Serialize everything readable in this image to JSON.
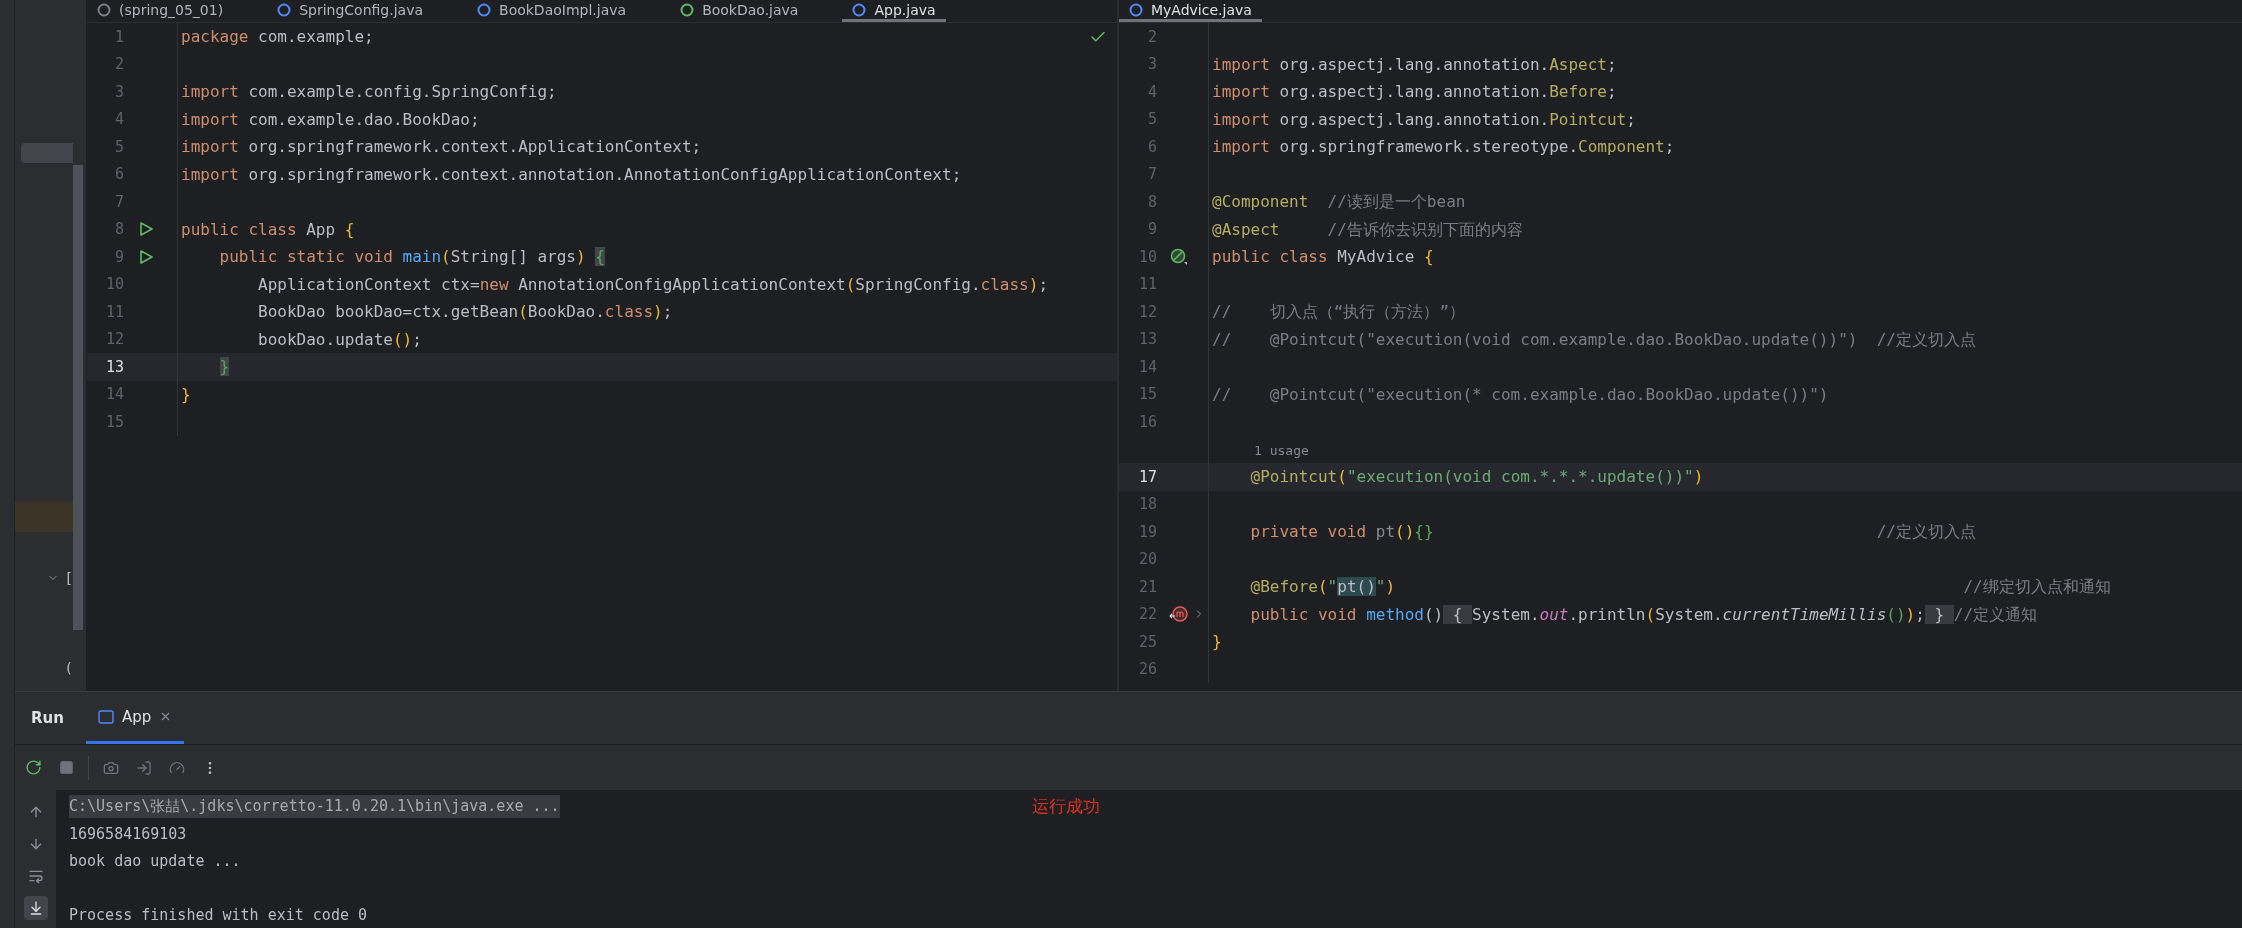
{
  "project_panel": {
    "tree_texts": [
      "[",
      "("
    ]
  },
  "left_editor": {
    "tabs": [
      {
        "label": "(spring_05_01)",
        "color": "#7a7e85",
        "selected": false
      },
      {
        "label": "SpringConfig.java",
        "color": "#548af7",
        "selected": false
      },
      {
        "label": "BookDaoImpl.java",
        "color": "#548af7",
        "selected": false
      },
      {
        "label": "BookDao.java",
        "color": "#5fb865",
        "selected": false
      },
      {
        "label": "App.java",
        "color": "#548af7",
        "selected": true
      }
    ],
    "lines": [
      {
        "kind": "code",
        "number": "1",
        "current": false,
        "tokens": [
          {
            "kind": "kw",
            "text": "package"
          },
          {
            "kind": "plain",
            "text": " com.example;"
          }
        ]
      },
      {
        "kind": "code",
        "number": "2",
        "current": false
      },
      {
        "kind": "code",
        "number": "3",
        "current": false,
        "tokens": [
          {
            "kind": "kw",
            "text": "import"
          },
          {
            "kind": "plain",
            "text": " com.example.config.SpringConfig;"
          }
        ]
      },
      {
        "kind": "code",
        "number": "4",
        "current": false,
        "tokens": [
          {
            "kind": "kw",
            "text": "import"
          },
          {
            "kind": "plain",
            "text": " com.example.dao.BookDao;"
          }
        ]
      },
      {
        "kind": "code",
        "number": "5",
        "current": false,
        "tokens": [
          {
            "kind": "kw",
            "text": "import"
          },
          {
            "kind": "plain",
            "text": " org.springframework.context.ApplicationContext;"
          }
        ]
      },
      {
        "kind": "code",
        "number": "6",
        "current": false,
        "tokens": [
          {
            "kind": "kw",
            "text": "import"
          },
          {
            "kind": "plain",
            "text": " org.springframework.context.annotation.AnnotationConfigApplicationContext;"
          }
        ]
      },
      {
        "kind": "code",
        "number": "7",
        "current": false
      },
      {
        "kind": "code",
        "number": "8",
        "current": false,
        "gutter": {
          "kind": "run"
        },
        "tokens": [
          {
            "kind": "kw",
            "text": "public class"
          },
          {
            "kind": "plain",
            "text": " App "
          },
          {
            "kind": "brace",
            "text": "{"
          }
        ]
      },
      {
        "kind": "code",
        "number": "9",
        "current": false,
        "gutter": {
          "kind": "run"
        },
        "tokens": [
          {
            "kind": "kw",
            "text": "    public static void "
          },
          {
            "kind": "decl",
            "text": "main"
          },
          {
            "kind": "brace",
            "text": "("
          },
          {
            "kind": "plain",
            "text": "String[] args"
          },
          {
            "kind": "brace",
            "text": ") "
          },
          {
            "kind": "match",
            "text": "{"
          }
        ]
      },
      {
        "kind": "code",
        "number": "10",
        "current": false,
        "tokens": [
          {
            "kind": "plain",
            "text": "        ApplicationContext ctx="
          },
          {
            "kind": "kw",
            "text": "new"
          },
          {
            "kind": "plain",
            "text": " AnnotationConfigApplicationContext"
          },
          {
            "kind": "brace",
            "text": "("
          },
          {
            "kind": "plain",
            "text": "SpringConfig."
          },
          {
            "kind": "kw",
            "text": "class"
          },
          {
            "kind": "brace",
            "text": ")"
          },
          {
            "kind": "plain",
            "text": ";"
          }
        ]
      },
      {
        "kind": "code",
        "number": "11",
        "current": false,
        "tokens": [
          {
            "kind": "plain",
            "text": "        BookDao bookDao=ctx.getBean"
          },
          {
            "kind": "brace",
            "text": "("
          },
          {
            "kind": "plain",
            "text": "BookDao."
          },
          {
            "kind": "kw",
            "text": "class"
          },
          {
            "kind": "brace",
            "text": ")"
          },
          {
            "kind": "plain",
            "text": ";"
          }
        ]
      },
      {
        "kind": "code",
        "number": "12",
        "current": false,
        "tokens": [
          {
            "kind": "plain",
            "text": "        bookDao.update"
          },
          {
            "kind": "brace",
            "text": "()"
          },
          {
            "kind": "plain",
            "text": ";"
          }
        ]
      },
      {
        "kind": "code",
        "number": "13",
        "current": true,
        "tokens": [
          {
            "kind": "match",
            "text": "    }"
          }
        ]
      },
      {
        "kind": "code",
        "number": "14",
        "current": false,
        "tokens": [
          {
            "kind": "brace",
            "text": "}"
          }
        ]
      },
      {
        "kind": "code",
        "number": "15",
        "current": false
      }
    ]
  },
  "right_editor": {
    "tabs": [
      {
        "label": "MyAdvice.java",
        "color": "#548af7",
        "selected": true
      }
    ],
    "lines": [
      {
        "kind": "code",
        "number": "2",
        "current": false
      },
      {
        "kind": "code",
        "number": "3",
        "current": false,
        "tokens": [
          {
            "kind": "kw",
            "text": "import"
          },
          {
            "kind": "plain",
            "text": " org.aspectj.lang.annotation."
          },
          {
            "kind": "annot",
            "text": "Aspect"
          },
          {
            "kind": "plain",
            "text": ";"
          }
        ]
      },
      {
        "kind": "code",
        "number": "4",
        "current": false,
        "tokens": [
          {
            "kind": "kw",
            "text": "import"
          },
          {
            "kind": "plain",
            "text": " org.aspectj.lang.annotation."
          },
          {
            "kind": "annot",
            "text": "Before"
          },
          {
            "kind": "plain",
            "text": ";"
          }
        ]
      },
      {
        "kind": "code",
        "number": "5",
        "current": false,
        "tokens": [
          {
            "kind": "kw",
            "text": "import"
          },
          {
            "kind": "plain",
            "text": " org.aspectj.lang.annotation."
          },
          {
            "kind": "annot",
            "text": "Pointcut"
          },
          {
            "kind": "plain",
            "text": ";"
          }
        ]
      },
      {
        "kind": "code",
        "number": "6",
        "current": false,
        "tokens": [
          {
            "kind": "kw",
            "text": "import"
          },
          {
            "kind": "plain",
            "text": " org.springframework.stereotype."
          },
          {
            "kind": "annot",
            "text": "Component"
          },
          {
            "kind": "plain",
            "text": ";"
          }
        ]
      },
      {
        "kind": "code",
        "number": "7",
        "current": false
      },
      {
        "kind": "code",
        "number": "8",
        "current": false,
        "tokens": [
          {
            "kind": "annot",
            "text": "@Component"
          },
          {
            "kind": "comment",
            "text": "  //读到是一个bean"
          }
        ]
      },
      {
        "kind": "code",
        "number": "9",
        "current": false,
        "tokens": [
          {
            "kind": "annot",
            "text": "@Aspect"
          },
          {
            "kind": "comment",
            "text": "     //告诉你去识别下面的内容"
          }
        ]
      },
      {
        "kind": "code",
        "number": "10",
        "current": false,
        "gutter": {
          "kind": "bean"
        },
        "tokens": [
          {
            "kind": "kw",
            "text": "public class"
          },
          {
            "kind": "plain",
            "text": " MyAdvice "
          },
          {
            "kind": "brace",
            "text": "{"
          }
        ]
      },
      {
        "kind": "code",
        "number": "11",
        "current": false
      },
      {
        "kind": "code",
        "number": "12",
        "current": false,
        "tokens": [
          {
            "kind": "comment",
            "text": "//    切入点（“执行（方法）”）"
          }
        ]
      },
      {
        "kind": "code",
        "number": "13",
        "current": false,
        "tokens": [
          {
            "kind": "comment",
            "text": "//    @Pointcut(\"execution(void com.example.dao.BookDao.update())\")  //定义切入点"
          }
        ]
      },
      {
        "kind": "code",
        "number": "14",
        "current": false
      },
      {
        "kind": "code",
        "number": "15",
        "current": false,
        "tokens": [
          {
            "kind": "comment",
            "text": "//    @Pointcut(\"execution(* com.example.dao.BookDao.update())\")"
          }
        ]
      },
      {
        "kind": "code",
        "number": "16",
        "current": false
      },
      {
        "kind": "inlay",
        "text": "1 usage",
        "current": false
      },
      {
        "kind": "code",
        "number": "17",
        "current": true,
        "tokens": [
          {
            "kind": "annot",
            "text": "    @Pointcut"
          },
          {
            "kind": "brace",
            "text": "("
          },
          {
            "kind": "str",
            "text": "\"execution(void com.*.*.*.update())\""
          },
          {
            "kind": "brace",
            "text": ")"
          }
        ]
      },
      {
        "kind": "code",
        "number": "18",
        "current": false
      },
      {
        "kind": "code",
        "number": "19",
        "current": false,
        "tokens": [
          {
            "kind": "kw",
            "text": "    private void "
          },
          {
            "kind": "dim",
            "text": "pt"
          },
          {
            "kind": "brace",
            "text": "()"
          },
          {
            "kind": "brace2",
            "text": "{}"
          },
          {
            "kind": "comment",
            "text": "                                              //定义切入点"
          }
        ]
      },
      {
        "kind": "code",
        "number": "20",
        "current": false
      },
      {
        "kind": "code",
        "number": "21",
        "current": false,
        "tokens": [
          {
            "kind": "annot",
            "text": "    @Before"
          },
          {
            "kind": "brace",
            "text": "("
          },
          {
            "kind": "str",
            "text": "\""
          },
          {
            "kind": "ref",
            "text": "pt()"
          },
          {
            "kind": "str",
            "text": "\""
          },
          {
            "kind": "brace",
            "text": ")"
          },
          {
            "kind": "comment",
            "text": "                                                           //绑定切入点和通知"
          }
        ]
      },
      {
        "kind": "code",
        "number": "22",
        "current": false,
        "gutter": {
          "kind": "advice"
        },
        "folded": true,
        "tokens": [
          {
            "kind": "kw",
            "text": "    public void "
          },
          {
            "kind": "decl",
            "text": "method"
          },
          {
            "kind": "plain",
            "text": "()"
          },
          {
            "kind": "fold",
            "text": " { "
          },
          {
            "kind": "plain",
            "text": "System."
          },
          {
            "kind": "field",
            "text": "out"
          },
          {
            "kind": "plain",
            "text": ".println"
          },
          {
            "kind": "brace",
            "text": "("
          },
          {
            "kind": "plain",
            "text": "System."
          },
          {
            "kind": "italic",
            "text": "currentTimeMillis"
          },
          {
            "kind": "brace2",
            "text": "()"
          },
          {
            "kind": "brace",
            "text": ")"
          },
          {
            "kind": "plain",
            "text": ";"
          },
          {
            "kind": "fold",
            "text": " } "
          },
          {
            "kind": "comment",
            "text": "//定义通知"
          }
        ]
      },
      {
        "kind": "code",
        "number": "25",
        "current": false,
        "tokens": [
          {
            "kind": "brace",
            "text": "}"
          }
        ]
      },
      {
        "kind": "code",
        "number": "26",
        "current": false
      }
    ]
  },
  "run_panel": {
    "title": "Run",
    "tabs": [
      {
        "label": "App",
        "selected": true
      }
    ],
    "side_tools": [
      {
        "kind": "up",
        "selected": false
      },
      {
        "kind": "down",
        "selected": false
      },
      {
        "kind": "wrap",
        "selected": false
      },
      {
        "kind": "scroll-end",
        "selected": true
      }
    ],
    "output": [
      {
        "kind": "command",
        "text": "C:\\Users\\张喆\\.jdks\\corretto-11.0.20.1\\bin\\java.exe ..."
      },
      {
        "kind": "stdout",
        "text": "1696584169103"
      },
      {
        "kind": "stdout",
        "text": "book dao update ..."
      },
      {
        "kind": "blank"
      },
      {
        "kind": "stdout",
        "text": "Process finished with exit code 0"
      }
    ],
    "note": "运行成功"
  }
}
